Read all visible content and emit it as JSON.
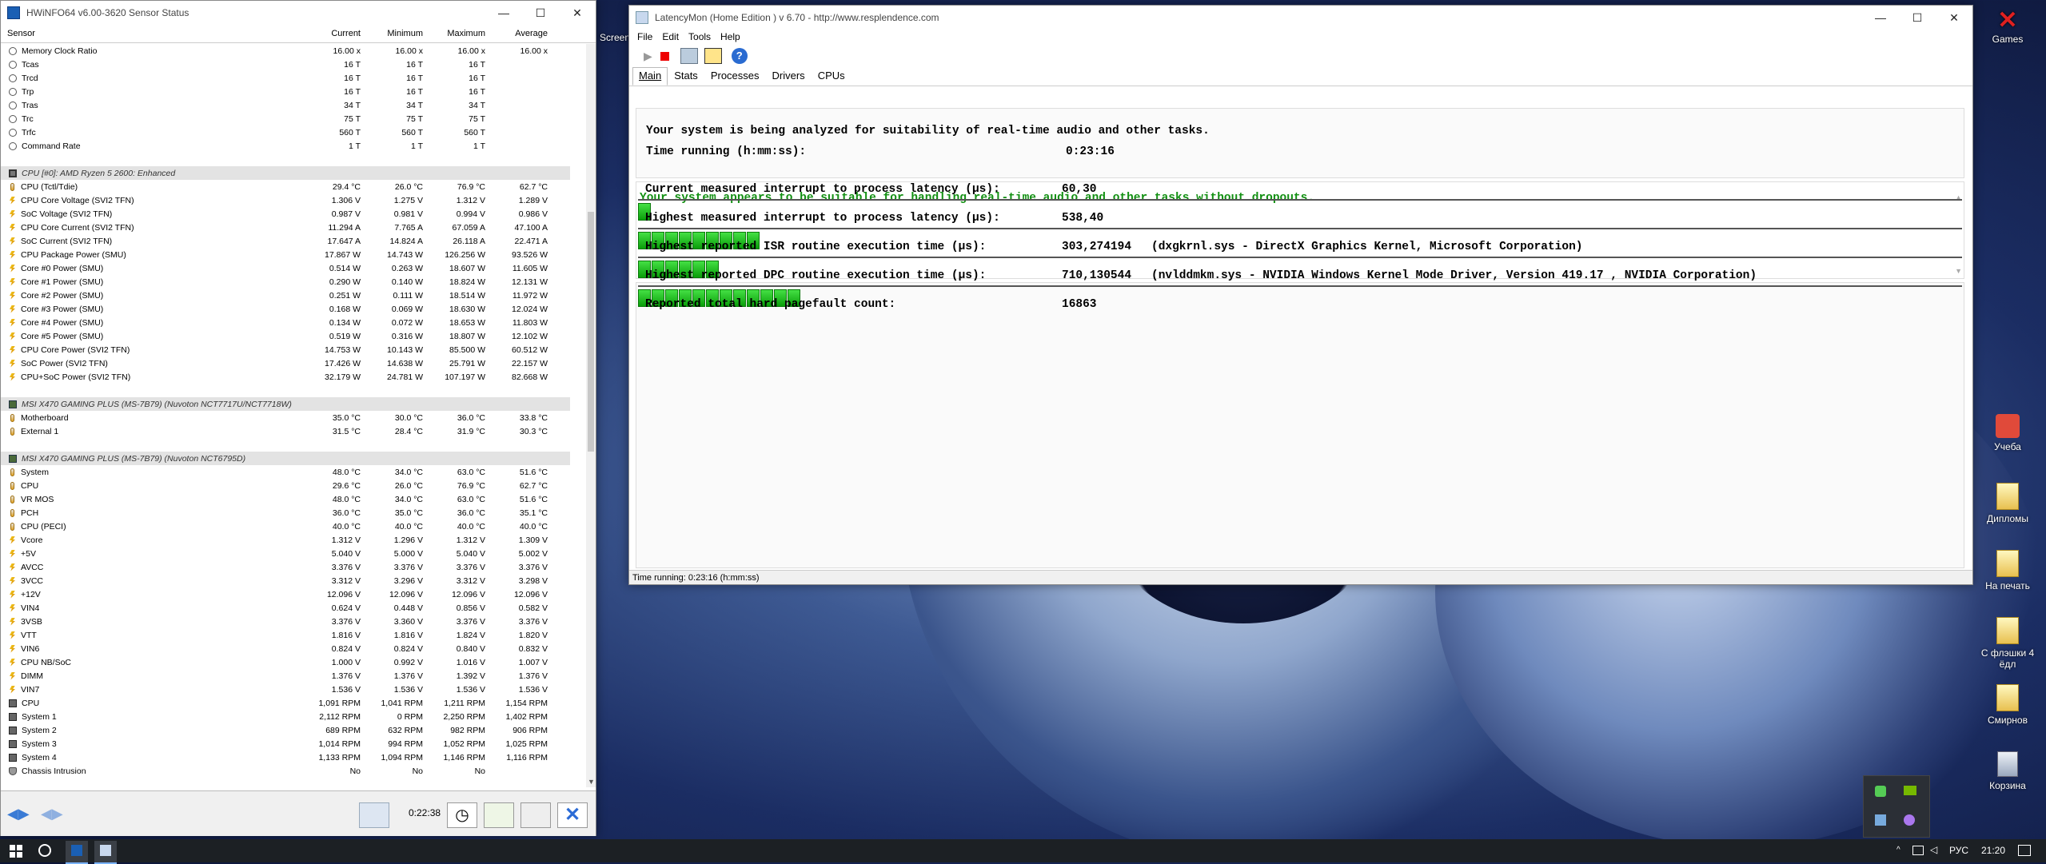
{
  "hwinfo": {
    "title": "HWiNFO64 v6.00-3620 Sensor Status",
    "columns": [
      "Sensor",
      "Current",
      "Minimum",
      "Maximum",
      "Average"
    ],
    "rows": [
      {
        "type": "row",
        "icon": "clock",
        "name": "Memory Clock Ratio",
        "cur": "16.00 x",
        "min": "16.00 x",
        "max": "16.00 x",
        "avg": "16.00 x"
      },
      {
        "type": "row",
        "icon": "clock",
        "name": "Tcas",
        "cur": "16 T",
        "min": "16 T",
        "max": "16 T",
        "avg": ""
      },
      {
        "type": "row",
        "icon": "clock",
        "name": "Trcd",
        "cur": "16 T",
        "min": "16 T",
        "max": "16 T",
        "avg": ""
      },
      {
        "type": "row",
        "icon": "clock",
        "name": "Trp",
        "cur": "16 T",
        "min": "16 T",
        "max": "16 T",
        "avg": ""
      },
      {
        "type": "row",
        "icon": "clock",
        "name": "Tras",
        "cur": "34 T",
        "min": "34 T",
        "max": "34 T",
        "avg": ""
      },
      {
        "type": "row",
        "icon": "clock",
        "name": "Trc",
        "cur": "75 T",
        "min": "75 T",
        "max": "75 T",
        "avg": ""
      },
      {
        "type": "row",
        "icon": "clock",
        "name": "Trfc",
        "cur": "560 T",
        "min": "560 T",
        "max": "560 T",
        "avg": ""
      },
      {
        "type": "row",
        "icon": "clock",
        "name": "Command Rate",
        "cur": "1 T",
        "min": "1 T",
        "max": "1 T",
        "avg": ""
      },
      {
        "type": "blank"
      },
      {
        "type": "section",
        "icon": "cpu",
        "name": "CPU [#0]: AMD Ryzen 5 2600: Enhanced"
      },
      {
        "type": "row",
        "icon": "therm",
        "name": "CPU (Tctl/Tdie)",
        "cur": "29.4 °C",
        "min": "26.0 °C",
        "max": "76.9 °C",
        "avg": "62.7 °C"
      },
      {
        "type": "row",
        "icon": "volt",
        "name": "CPU Core Voltage (SVI2 TFN)",
        "cur": "1.306 V",
        "min": "1.275 V",
        "max": "1.312 V",
        "avg": "1.289 V"
      },
      {
        "type": "row",
        "icon": "volt",
        "name": "SoC Voltage (SVI2 TFN)",
        "cur": "0.987 V",
        "min": "0.981 V",
        "max": "0.994 V",
        "avg": "0.986 V"
      },
      {
        "type": "row",
        "icon": "volt",
        "name": "CPU Core Current (SVI2 TFN)",
        "cur": "11.294 A",
        "min": "7.765 A",
        "max": "67.059 A",
        "avg": "47.100 A"
      },
      {
        "type": "row",
        "icon": "volt",
        "name": "SoC Current (SVI2 TFN)",
        "cur": "17.647 A",
        "min": "14.824 A",
        "max": "26.118 A",
        "avg": "22.471 A"
      },
      {
        "type": "row",
        "icon": "volt",
        "name": "CPU Package Power (SMU)",
        "cur": "17.867 W",
        "min": "14.743 W",
        "max": "126.256 W",
        "avg": "93.526 W"
      },
      {
        "type": "row",
        "icon": "volt",
        "name": "Core #0 Power (SMU)",
        "cur": "0.514 W",
        "min": "0.263 W",
        "max": "18.607 W",
        "avg": "11.605 W"
      },
      {
        "type": "row",
        "icon": "volt",
        "name": "Core #1 Power (SMU)",
        "cur": "0.290 W",
        "min": "0.140 W",
        "max": "18.824 W",
        "avg": "12.131 W"
      },
      {
        "type": "row",
        "icon": "volt",
        "name": "Core #2 Power (SMU)",
        "cur": "0.251 W",
        "min": "0.111 W",
        "max": "18.514 W",
        "avg": "11.972 W"
      },
      {
        "type": "row",
        "icon": "volt",
        "name": "Core #3 Power (SMU)",
        "cur": "0.168 W",
        "min": "0.069 W",
        "max": "18.630 W",
        "avg": "12.024 W"
      },
      {
        "type": "row",
        "icon": "volt",
        "name": "Core #4 Power (SMU)",
        "cur": "0.134 W",
        "min": "0.072 W",
        "max": "18.653 W",
        "avg": "11.803 W"
      },
      {
        "type": "row",
        "icon": "volt",
        "name": "Core #5 Power (SMU)",
        "cur": "0.519 W",
        "min": "0.316 W",
        "max": "18.807 W",
        "avg": "12.102 W"
      },
      {
        "type": "row",
        "icon": "volt",
        "name": "CPU Core Power (SVI2 TFN)",
        "cur": "14.753 W",
        "min": "10.143 W",
        "max": "85.500 W",
        "avg": "60.512 W"
      },
      {
        "type": "row",
        "icon": "volt",
        "name": "SoC Power (SVI2 TFN)",
        "cur": "17.426 W",
        "min": "14.638 W",
        "max": "25.791 W",
        "avg": "22.157 W"
      },
      {
        "type": "row",
        "icon": "volt",
        "name": "CPU+SoC Power (SVI2 TFN)",
        "cur": "32.179 W",
        "min": "24.781 W",
        "max": "107.197 W",
        "avg": "82.668 W"
      },
      {
        "type": "blank"
      },
      {
        "type": "section",
        "icon": "board",
        "name": "MSI X470 GAMING PLUS (MS-7B79) (Nuvoton NCT7717U/NCT7718W)"
      },
      {
        "type": "row",
        "icon": "therm",
        "name": "Motherboard",
        "cur": "35.0 °C",
        "min": "30.0 °C",
        "max": "36.0 °C",
        "avg": "33.8 °C"
      },
      {
        "type": "row",
        "icon": "therm",
        "name": "External 1",
        "cur": "31.5 °C",
        "min": "28.4 °C",
        "max": "31.9 °C",
        "avg": "30.3 °C"
      },
      {
        "type": "blank"
      },
      {
        "type": "section",
        "icon": "board",
        "name": "MSI X470 GAMING PLUS (MS-7B79) (Nuvoton NCT6795D)"
      },
      {
        "type": "row",
        "icon": "therm",
        "name": "System",
        "cur": "48.0 °C",
        "min": "34.0 °C",
        "max": "63.0 °C",
        "avg": "51.6 °C"
      },
      {
        "type": "row",
        "icon": "therm",
        "name": "CPU",
        "cur": "29.6 °C",
        "min": "26.0 °C",
        "max": "76.9 °C",
        "avg": "62.7 °C"
      },
      {
        "type": "row",
        "icon": "therm",
        "name": "VR MOS",
        "cur": "48.0 °C",
        "min": "34.0 °C",
        "max": "63.0 °C",
        "avg": "51.6 °C"
      },
      {
        "type": "row",
        "icon": "therm",
        "name": "PCH",
        "cur": "36.0 °C",
        "min": "35.0 °C",
        "max": "36.0 °C",
        "avg": "35.1 °C"
      },
      {
        "type": "row",
        "icon": "therm",
        "name": "CPU (PECI)",
        "cur": "40.0 °C",
        "min": "40.0 °C",
        "max": "40.0 °C",
        "avg": "40.0 °C"
      },
      {
        "type": "row",
        "icon": "volt",
        "name": "Vcore",
        "cur": "1.312 V",
        "min": "1.296 V",
        "max": "1.312 V",
        "avg": "1.309 V"
      },
      {
        "type": "row",
        "icon": "volt",
        "name": "+5V",
        "cur": "5.040 V",
        "min": "5.000 V",
        "max": "5.040 V",
        "avg": "5.002 V"
      },
      {
        "type": "row",
        "icon": "volt",
        "name": "AVCC",
        "cur": "3.376 V",
        "min": "3.376 V",
        "max": "3.376 V",
        "avg": "3.376 V"
      },
      {
        "type": "row",
        "icon": "volt",
        "name": "3VCC",
        "cur": "3.312 V",
        "min": "3.296 V",
        "max": "3.312 V",
        "avg": "3.298 V"
      },
      {
        "type": "row",
        "icon": "volt",
        "name": "+12V",
        "cur": "12.096 V",
        "min": "12.096 V",
        "max": "12.096 V",
        "avg": "12.096 V"
      },
      {
        "type": "row",
        "icon": "volt",
        "name": "VIN4",
        "cur": "0.624 V",
        "min": "0.448 V",
        "max": "0.856 V",
        "avg": "0.582 V"
      },
      {
        "type": "row",
        "icon": "volt",
        "name": "3VSB",
        "cur": "3.376 V",
        "min": "3.360 V",
        "max": "3.376 V",
        "avg": "3.376 V"
      },
      {
        "type": "row",
        "icon": "volt",
        "name": "VTT",
        "cur": "1.816 V",
        "min": "1.816 V",
        "max": "1.824 V",
        "avg": "1.820 V"
      },
      {
        "type": "row",
        "icon": "volt",
        "name": "VIN6",
        "cur": "0.824 V",
        "min": "0.824 V",
        "max": "0.840 V",
        "avg": "0.832 V"
      },
      {
        "type": "row",
        "icon": "volt",
        "name": "CPU NB/SoC",
        "cur": "1.000 V",
        "min": "0.992 V",
        "max": "1.016 V",
        "avg": "1.007 V"
      },
      {
        "type": "row",
        "icon": "volt",
        "name": "DIMM",
        "cur": "1.376 V",
        "min": "1.376 V",
        "max": "1.392 V",
        "avg": "1.376 V"
      },
      {
        "type": "row",
        "icon": "volt",
        "name": "VIN7",
        "cur": "1.536 V",
        "min": "1.536 V",
        "max": "1.536 V",
        "avg": "1.536 V"
      },
      {
        "type": "row",
        "icon": "fan",
        "name": "CPU",
        "cur": "1,091 RPM",
        "min": "1,041 RPM",
        "max": "1,211 RPM",
        "avg": "1,154 RPM"
      },
      {
        "type": "row",
        "icon": "fan",
        "name": "System 1",
        "cur": "2,112 RPM",
        "min": "0 RPM",
        "max": "2,250 RPM",
        "avg": "1,402 RPM"
      },
      {
        "type": "row",
        "icon": "fan",
        "name": "System 2",
        "cur": "689 RPM",
        "min": "632 RPM",
        "max": "982 RPM",
        "avg": "906 RPM"
      },
      {
        "type": "row",
        "icon": "fan",
        "name": "System 3",
        "cur": "1,014 RPM",
        "min": "994 RPM",
        "max": "1,052 RPM",
        "avg": "1,025 RPM"
      },
      {
        "type": "row",
        "icon": "fan",
        "name": "System 4",
        "cur": "1,133 RPM",
        "min": "1,094 RPM",
        "max": "1,146 RPM",
        "avg": "1,116 RPM"
      },
      {
        "type": "row",
        "icon": "shield",
        "name": "Chassis Intrusion",
        "cur": "No",
        "min": "No",
        "max": "No",
        "avg": ""
      }
    ],
    "elapsed": "0:22:38"
  },
  "latencymon": {
    "title": "LatencyMon  (Home Edition )  v 6.70 - http://www.resplendence.com",
    "menu": [
      "File",
      "Edit",
      "Tools",
      "Help"
    ],
    "tabs": [
      "Main",
      "Stats",
      "Processes",
      "Drivers",
      "CPUs"
    ],
    "analysis_line": "Your system is being analyzed for suitability of real-time audio and other tasks.",
    "time_label": "Time running (h:mm:ss):",
    "time_value": "0:23:16",
    "verdict": "Your system appears to be suitable for handling real-time audio and other tasks without dropouts.",
    "metrics": [
      {
        "label": "Current measured interrupt to process latency (µs):",
        "value": "60,30",
        "detail": "",
        "fill_blocks": 1
      },
      {
        "label": "Highest measured interrupt to process latency (µs):",
        "value": "538,40",
        "detail": "",
        "fill_blocks": 9
      },
      {
        "label": "Highest reported ISR routine execution time (µs):",
        "value": "303,274194",
        "detail": "(dxgkrnl.sys - DirectX Graphics Kernel, Microsoft Corporation)",
        "fill_blocks": 6
      },
      {
        "label": "Highest reported DPC routine execution time (µs):",
        "value": "710,130544",
        "detail": "(nvlddmkm.sys - NVIDIA Windows Kernel Mode Driver, Version 419.17 , NVIDIA Corporation)",
        "fill_blocks": 12
      }
    ],
    "pagefault_label": "Reported total hard pagefault count:",
    "pagefault_value": "16863",
    "status": "Time running: 0:23:16  (h:mm:ss)",
    "bar_color": "#22c722"
  },
  "desktop": {
    "icons": [
      "Games",
      "Учеба",
      "Дипломы",
      "На печать",
      "С флэшки 4 ёдл",
      "Смирнов",
      "Корзина"
    ],
    "truncated_label": "Screen"
  },
  "taskbar": {
    "lang": "РУС",
    "time": "21:20"
  }
}
